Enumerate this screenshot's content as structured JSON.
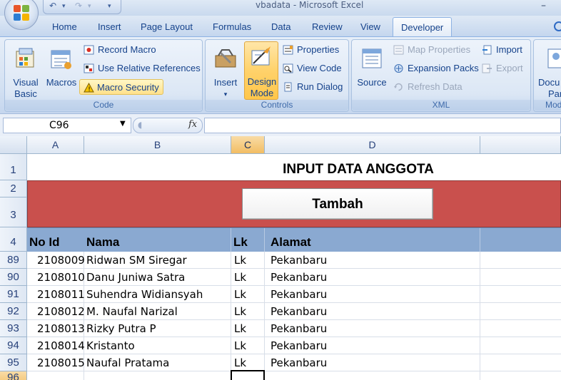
{
  "window": {
    "title": "vbadata - Microsoft Excel"
  },
  "tabs": [
    {
      "label": "Home"
    },
    {
      "label": "Insert"
    },
    {
      "label": "Page Layout"
    },
    {
      "label": "Formulas"
    },
    {
      "label": "Data"
    },
    {
      "label": "Review"
    },
    {
      "label": "View"
    },
    {
      "label": "Developer"
    }
  ],
  "active_tab": "Developer",
  "ribbon": {
    "code": {
      "label": "Code",
      "visual_basic": "Visual Basic",
      "visual_basic_line1": "Visual",
      "visual_basic_line2": "Basic",
      "macros": "Macros",
      "record_macro": "Record Macro",
      "use_relative": "Use Relative References",
      "macro_security": "Macro Security"
    },
    "controls": {
      "label": "Controls",
      "insert": "Insert",
      "design_mode_line1": "Design",
      "design_mode_line2": "Mode",
      "properties": "Properties",
      "view_code": "View Code",
      "run_dialog": "Run Dialog"
    },
    "xml": {
      "label": "XML",
      "source": "Source",
      "map_properties": "Map Properties",
      "expansion_packs": "Expansion Packs",
      "refresh_data": "Refresh Data",
      "import": "Import",
      "export": "Export"
    },
    "modify": {
      "label": "Mod",
      "docu_line1": "Docu",
      "docu_line2": "Par"
    }
  },
  "formula_bar": {
    "name_box": "C96",
    "fx": "fx",
    "value": ""
  },
  "sheet": {
    "columns": [
      {
        "label": "A"
      },
      {
        "label": "B"
      },
      {
        "label": "C"
      },
      {
        "label": "D"
      }
    ],
    "selected_column": "C",
    "row_numbers": {
      "r1": "1",
      "r2": "2",
      "r3": "3",
      "r4": "4",
      "r96": "96"
    },
    "title": "INPUT DATA ANGGOTA",
    "button_label": "Tambah",
    "headers": {
      "id": "No Id",
      "name": "Nama",
      "lk": "Lk",
      "address": "Alamat"
    },
    "rows": [
      {
        "row": "89",
        "id": "2108009",
        "name": "Ridwan SM Siregar",
        "lk": "Lk",
        "address": "Pekanbaru"
      },
      {
        "row": "90",
        "id": "2108010",
        "name": "Danu Juniwa Satra",
        "lk": "Lk",
        "address": "Pekanbaru"
      },
      {
        "row": "91",
        "id": "2108011",
        "name": "Suhendra Widiansyah",
        "lk": "Lk",
        "address": "Pekanbaru"
      },
      {
        "row": "92",
        "id": "2108012",
        "name": "M. Naufal Narizal",
        "lk": "Lk",
        "address": "Pekanbaru"
      },
      {
        "row": "93",
        "id": "2108013",
        "name": "Rizky Putra P",
        "lk": "Lk",
        "address": "Pekanbaru"
      },
      {
        "row": "94",
        "id": "2108014",
        "name": "Kristanto",
        "lk": "Lk",
        "address": "Pekanbaru"
      },
      {
        "row": "95",
        "id": "2108015",
        "name": "Naufal Pratama",
        "lk": "Lk",
        "address": "Pekanbaru"
      }
    ]
  }
}
